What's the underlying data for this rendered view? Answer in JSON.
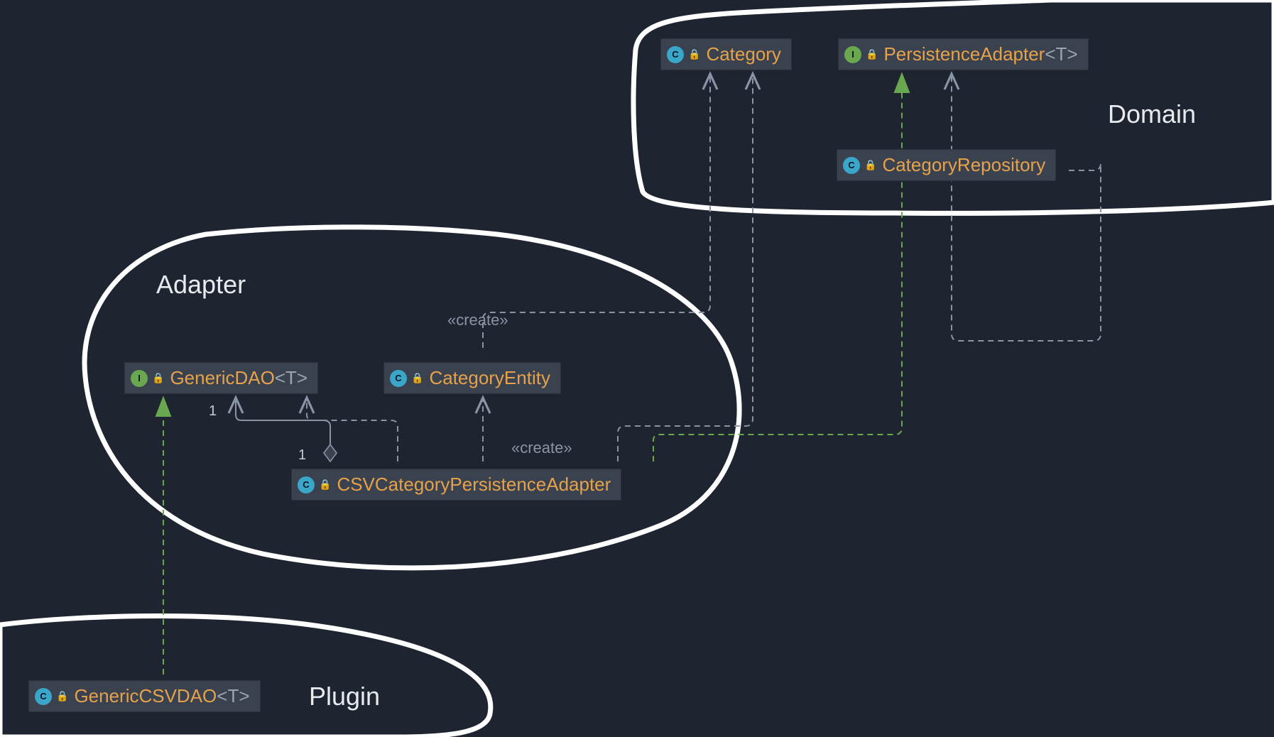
{
  "regions": {
    "domain": "Domain",
    "adapter": "Adapter",
    "plugin": "Plugin"
  },
  "nodes": {
    "category": {
      "kind": "class",
      "name": "Category",
      "generic": ""
    },
    "persistenceAdapter": {
      "kind": "interface",
      "name": "PersistenceAdapter",
      "generic": "<T>"
    },
    "categoryRepository": {
      "kind": "class",
      "name": "CategoryRepository",
      "generic": ""
    },
    "genericDAO": {
      "kind": "interface",
      "name": "GenericDAO",
      "generic": "<T>"
    },
    "categoryEntity": {
      "kind": "class",
      "name": "CategoryEntity",
      "generic": ""
    },
    "csvCategoryPersistenceAdapter": {
      "kind": "class",
      "name": "CSVCategoryPersistenceAdapter",
      "generic": ""
    },
    "genericCSVDAO": {
      "kind": "class",
      "name": "GenericCSVDAO",
      "generic": "<T>"
    }
  },
  "badges": {
    "class": "C",
    "interface": "I"
  },
  "edgeLabels": {
    "create1": "«create»",
    "create2": "«create»",
    "mult1": "1",
    "mult2": "1"
  },
  "colors": {
    "bg": "#1e2430",
    "nodeBg": "#3a4250",
    "className": "#e6a24a",
    "generic": "#9aa4b3",
    "region": "#e8eaed",
    "edgeGray": "#8a94a6",
    "edgeGreen": "#6aa84f",
    "freehand": "#ffffff"
  }
}
